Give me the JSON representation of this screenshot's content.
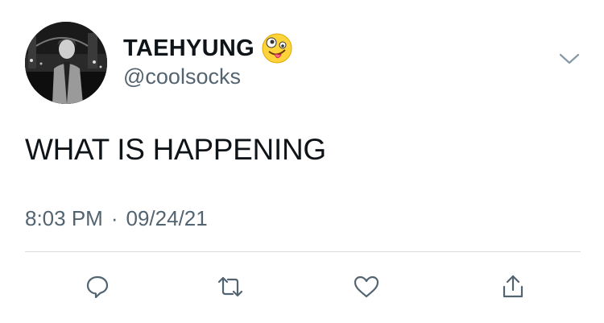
{
  "tweet": {
    "author": {
      "display_name": "TAEHYUNG",
      "handle": "@coolsocks",
      "name_emoji": "zany-face-emoji"
    },
    "text": "WHAT IS HAPPENING",
    "time": "8:03 PM",
    "separator": "·",
    "date": "09/24/21"
  },
  "icons": {
    "menu": "chevron-down-icon",
    "reply": "reply-icon",
    "retweet": "retweet-icon",
    "like": "heart-icon",
    "share": "share-icon"
  },
  "colors": {
    "text_primary": "#0f1419",
    "text_secondary": "#536471",
    "icon": "#536471",
    "divider": "#d9dde0"
  }
}
